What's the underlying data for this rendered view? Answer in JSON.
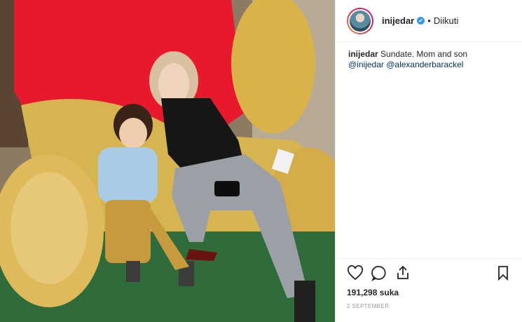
{
  "post": {
    "username": "inijedar",
    "verified_mark": "✔",
    "separator": "•",
    "follow_status": "Diikuti",
    "caption": {
      "author": "inijedar",
      "text": "Sundate. Mom and son",
      "mentions": [
        "@inijedar",
        "@alexanderbarackel"
      ]
    },
    "likes": "191,298 suka",
    "date": "2 SEPTEMBER",
    "icons": [
      "heart-icon",
      "comment-icon",
      "share-icon",
      "bookmark-icon"
    ]
  },
  "colors": {
    "accent": "#3897f0",
    "text": "#262626",
    "muted": "#999999",
    "border": "#efefef"
  }
}
